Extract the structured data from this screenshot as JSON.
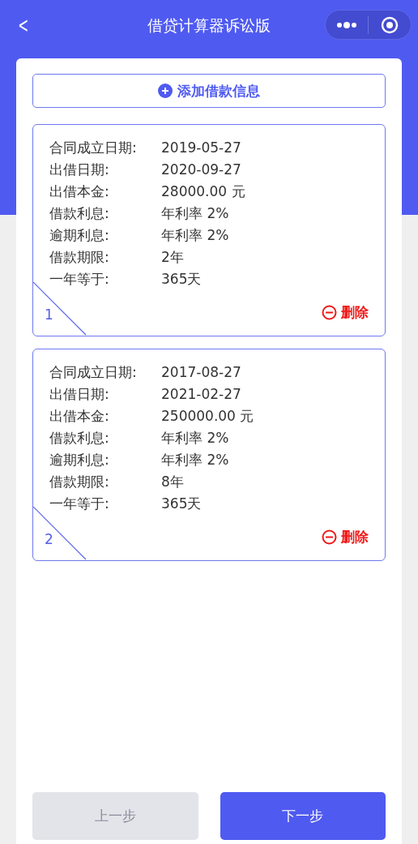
{
  "header": {
    "back": "<",
    "title": "借贷计算器诉讼版"
  },
  "add_button": {
    "label": "添加借款信息"
  },
  "loans": [
    {
      "index": "1",
      "delete": "删除",
      "fields": [
        {
          "label": "合同成立日期:",
          "value": "2019-05-27"
        },
        {
          "label": "出借日期:",
          "value": "2020-09-27"
        },
        {
          "label": "出借本金:",
          "value": "28000.00 元"
        },
        {
          "label": "借款利息:",
          "value": "年利率 2%"
        },
        {
          "label": "逾期利息:",
          "value": "年利率 2%"
        },
        {
          "label": "借款期限:",
          "value": "2年"
        },
        {
          "label": "一年等于:",
          "value": "365天"
        }
      ]
    },
    {
      "index": "2",
      "delete": "删除",
      "fields": [
        {
          "label": "合同成立日期:",
          "value": "2017-08-27"
        },
        {
          "label": "出借日期:",
          "value": "2021-02-27"
        },
        {
          "label": "出借本金:",
          "value": "250000.00 元"
        },
        {
          "label": "借款利息:",
          "value": "年利率 2%"
        },
        {
          "label": "逾期利息:",
          "value": "年利率 2%"
        },
        {
          "label": "借款期限:",
          "value": "8年"
        },
        {
          "label": "一年等于:",
          "value": "365天"
        }
      ]
    }
  ],
  "footer": [
    {
      "label": "上一步",
      "disabled": true
    },
    {
      "label": "下一步",
      "disabled": false
    }
  ]
}
